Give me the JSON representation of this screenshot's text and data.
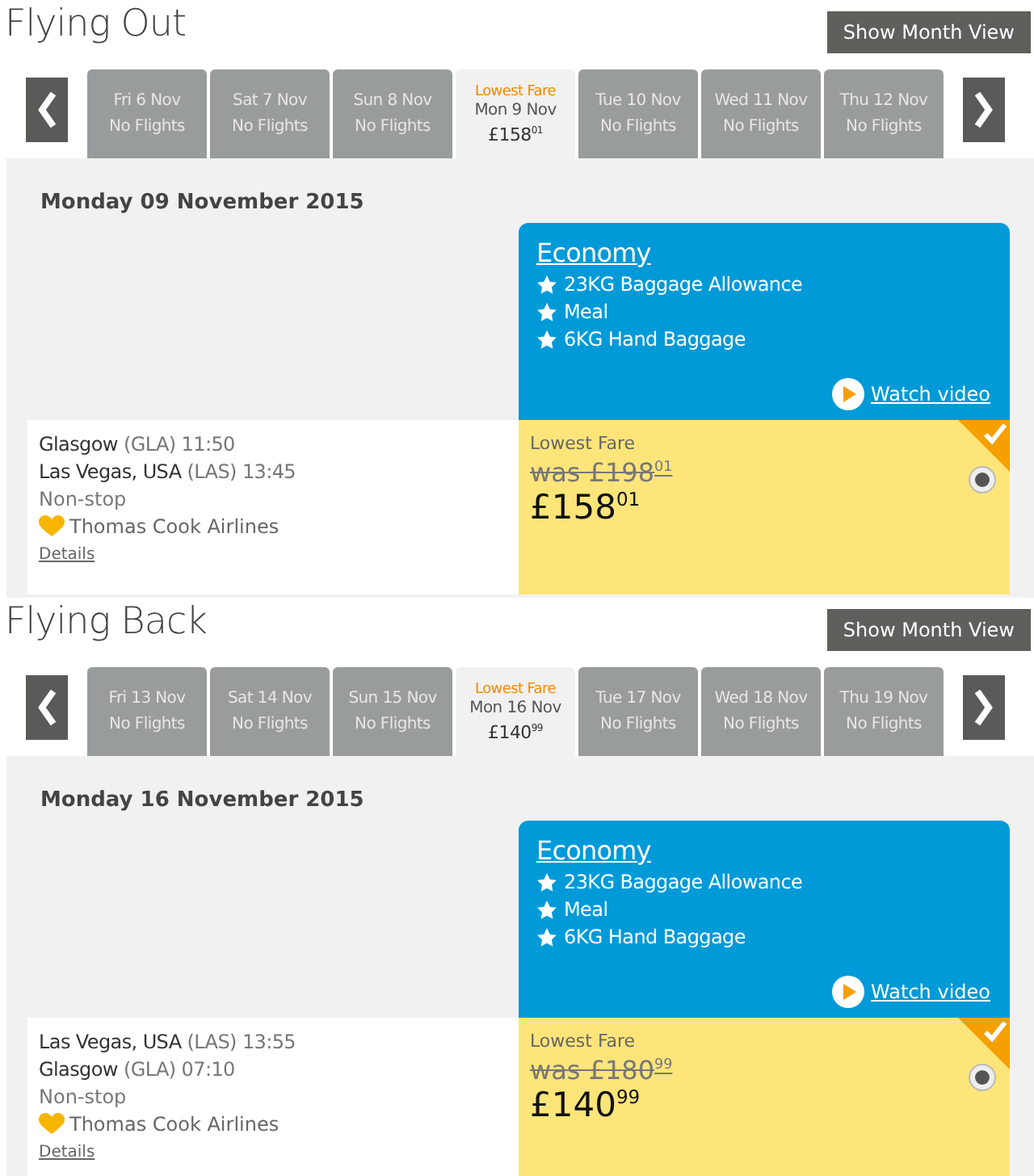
{
  "sections": [
    {
      "title": "Flying Out",
      "month_button": "Show Month View",
      "days": [
        {
          "date": "Fri 6 Nov",
          "info": "No Flights",
          "selected": false
        },
        {
          "date": "Sat 7 Nov",
          "info": "No Flights",
          "selected": false
        },
        {
          "date": "Sun 8 Nov",
          "info": "No Flights",
          "selected": false
        },
        {
          "badge": "Lowest Fare",
          "date": "Mon 9 Nov",
          "info": "£158$^{01}$",
          "selected": true
        },
        {
          "date": "Tue 10 Nov",
          "info": "No Flights",
          "selected": false
        },
        {
          "date": "Wed 11 Nov",
          "info": "No Flights",
          "selected": false
        },
        {
          "date": "Thu 12 Nov",
          "info": "No Flights",
          "selected": false
        }
      ],
      "heading": "Monday 09 November 2015",
      "fare_class": {
        "name": "Economy",
        "features": [
          "23KG Baggage Allowance",
          "Meal",
          "6KG Hand Baggage"
        ],
        "video_link": "Watch video"
      },
      "flight": {
        "depart": {
          "place": "Glasgow",
          "code": "(GLA)",
          "time": "11:50"
        },
        "arrive": {
          "place": "Las Vegas, USA",
          "code": "(LAS)",
          "time": "13:45"
        },
        "stops": "Non-stop",
        "airline": "Thomas Cook Airlines",
        "details_link": "Details"
      },
      "fare": {
        "label": "Lowest Fare",
        "was": "was £198$^{01}$",
        "price": "£158$^{01}$",
        "selected": true
      }
    },
    {
      "title": "Flying Back",
      "month_button": "Show Month View",
      "days": [
        {
          "date": "Fri 13 Nov",
          "info": "No Flights",
          "selected": false
        },
        {
          "date": "Sat 14 Nov",
          "info": "No Flights",
          "selected": false
        },
        {
          "date": "Sun 15 Nov",
          "info": "No Flights",
          "selected": false
        },
        {
          "badge": "Lowest Fare",
          "date": "Mon 16 Nov",
          "info": "£140$^{99}$",
          "selected": true
        },
        {
          "date": "Tue 17 Nov",
          "info": "No Flights",
          "selected": false
        },
        {
          "date": "Wed 18 Nov",
          "info": "No Flights",
          "selected": false
        },
        {
          "date": "Thu 19 Nov",
          "info": "No Flights",
          "selected": false
        }
      ],
      "heading": "Monday 16 November 2015",
      "fare_class": {
        "name": "Economy",
        "features": [
          "23KG Baggage Allowance",
          "Meal",
          "6KG Hand Baggage"
        ],
        "video_link": "Watch video"
      },
      "flight": {
        "depart": {
          "place": "Las Vegas, USA",
          "code": "(LAS)",
          "time": "13:55"
        },
        "arrive": {
          "place": "Glasgow",
          "code": "(GLA)",
          "time": "07:10"
        },
        "stops": "Non-stop",
        "airline": "Thomas Cook Airlines",
        "details_link": "Details"
      },
      "fare": {
        "label": "Lowest Fare",
        "was": "was £180$^{99}$",
        "price": "£140$^{99}$",
        "selected": true
      }
    }
  ]
}
